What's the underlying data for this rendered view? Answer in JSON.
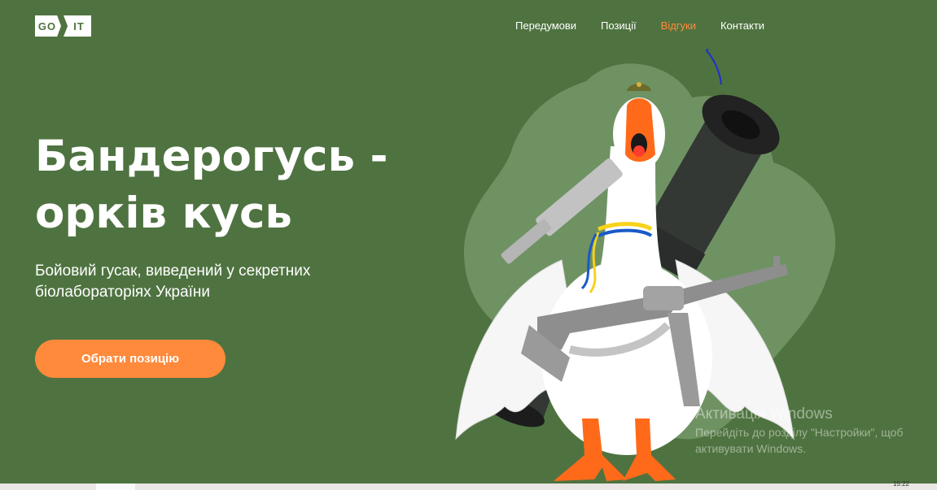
{
  "logo": {
    "left": "GO",
    "right": "IT"
  },
  "nav": {
    "items": [
      {
        "label": "Передумови",
        "active": false
      },
      {
        "label": "Позиції",
        "active": false
      },
      {
        "label": "Відгуки",
        "active": true
      },
      {
        "label": "Контакти",
        "active": false
      }
    ]
  },
  "hero": {
    "title": "Бандерогусь - орків кусь",
    "subtitle": "Бойовий гусак, виведений у секретних біолабораторіях України",
    "cta_label": "Обрати позицію",
    "illustration": "armed-goose-illustration"
  },
  "watermark": {
    "title": "Активація Windows",
    "description": "Перейдіть до розділу \"Настройки\", щоб активувати Windows."
  },
  "taskbar": {
    "clock": "15:22"
  },
  "colors": {
    "background": "#4f7340",
    "accent": "#ff8a3c",
    "text": "#ffffff"
  }
}
